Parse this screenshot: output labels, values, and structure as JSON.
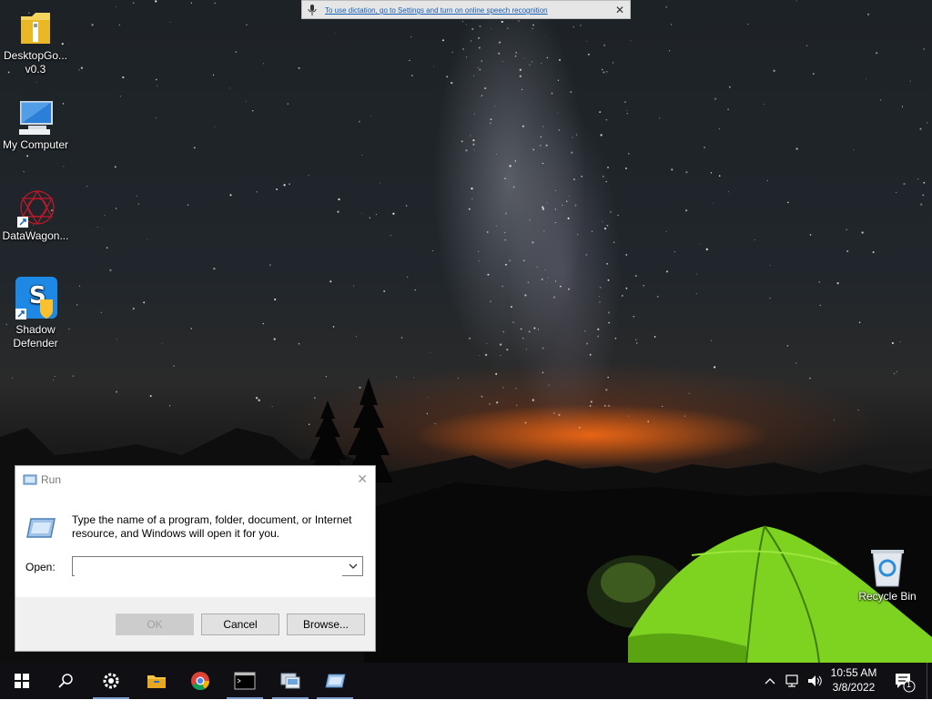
{
  "dictation": {
    "message": "To use dictation, go to Settings and turn on online speech recognition",
    "close": "✕"
  },
  "desktop_icons": [
    {
      "label": "DesktopGo... v0.3",
      "icon": "folder-zip-icon"
    },
    {
      "label": "My Computer",
      "icon": "computer-icon"
    },
    {
      "label": "DataWagon...",
      "icon": "datawagon-icon"
    },
    {
      "label": "Shadow Defender",
      "icon": "shadow-defender-icon"
    },
    {
      "label": "Recycle Bin",
      "icon": "recycle-bin-icon"
    }
  ],
  "run_dialog": {
    "title": "Run",
    "close": "✕",
    "description": "Type the name of a program, folder, document, or Internet resource, and Windows will open it for you.",
    "open_label": "Open:",
    "open_value": "",
    "ok": "OK",
    "cancel": "Cancel",
    "browse": "Browse..."
  },
  "taskbar": {
    "items": [
      "start-icon",
      "search-icon",
      "settings-icon",
      "file-explorer-icon",
      "chrome-icon",
      "terminal-icon",
      "network-app-icon",
      "run-app-icon"
    ],
    "time": "10:55 AM",
    "date": "3/8/2022",
    "notifications_count": "1"
  },
  "colors": {
    "taskbar": "#0f0f14",
    "dialog_footer": "#f0f0f0",
    "tent_green": "#7ed321",
    "sunset_orange": "#ff6e14"
  }
}
